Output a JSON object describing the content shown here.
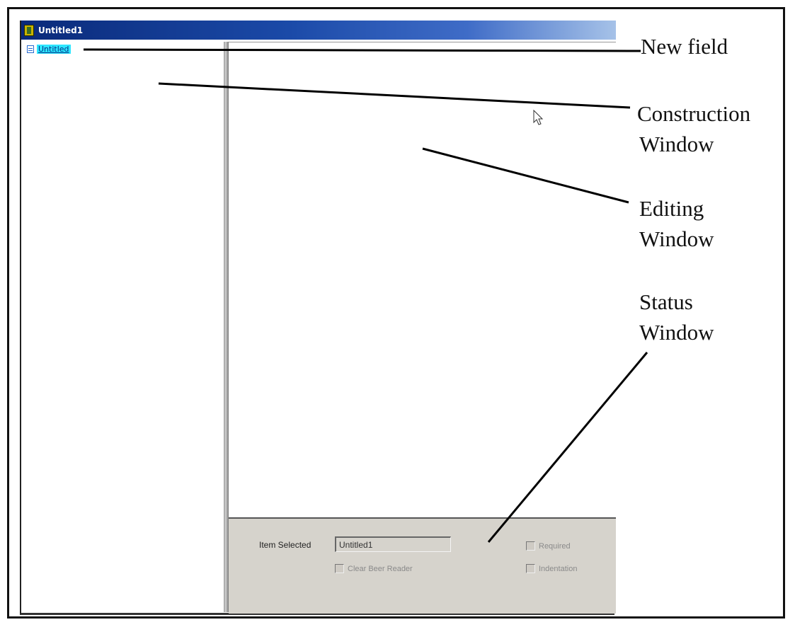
{
  "window": {
    "title": "Untitled1"
  },
  "tree": {
    "item_label": "Untitled"
  },
  "status": {
    "item_selected_label": "Item Selected",
    "item_selected_value": "Untitled1",
    "options": [
      {
        "label": "Clear Beer Reader",
        "checked": false
      },
      {
        "label": "Required",
        "checked": false
      },
      {
        "label": "Indentation",
        "checked": false
      }
    ]
  },
  "annotations": {
    "new_field": "New field",
    "construction_window": [
      "Construction",
      "Window"
    ],
    "editing_window": [
      "Editing",
      "Window"
    ],
    "status_window": [
      "Status",
      "Window"
    ]
  },
  "icons": {
    "app": "document-app-icon",
    "tree": "field-node-icon",
    "cursor": "mouse-pointer-icon"
  }
}
